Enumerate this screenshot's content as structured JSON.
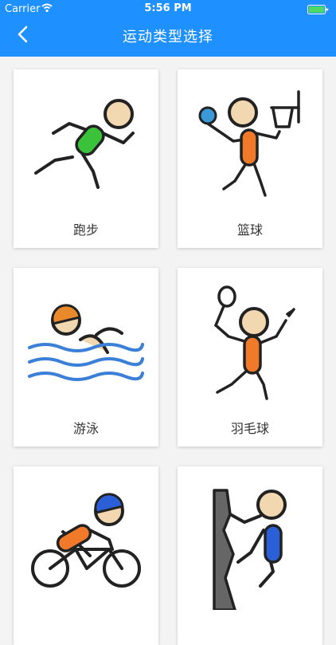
{
  "status_bar": {
    "carrier": "Carrier",
    "time": "5:56 PM"
  },
  "nav": {
    "title": "运动类型选择"
  },
  "sports": [
    {
      "label": "跑步",
      "icon": "running-icon"
    },
    {
      "label": "篮球",
      "icon": "basketball-icon"
    },
    {
      "label": "游泳",
      "icon": "swimming-icon"
    },
    {
      "label": "羽毛球",
      "icon": "badminton-icon"
    },
    {
      "label": "",
      "icon": "cycling-icon"
    },
    {
      "label": "",
      "icon": "climbing-icon"
    }
  ]
}
